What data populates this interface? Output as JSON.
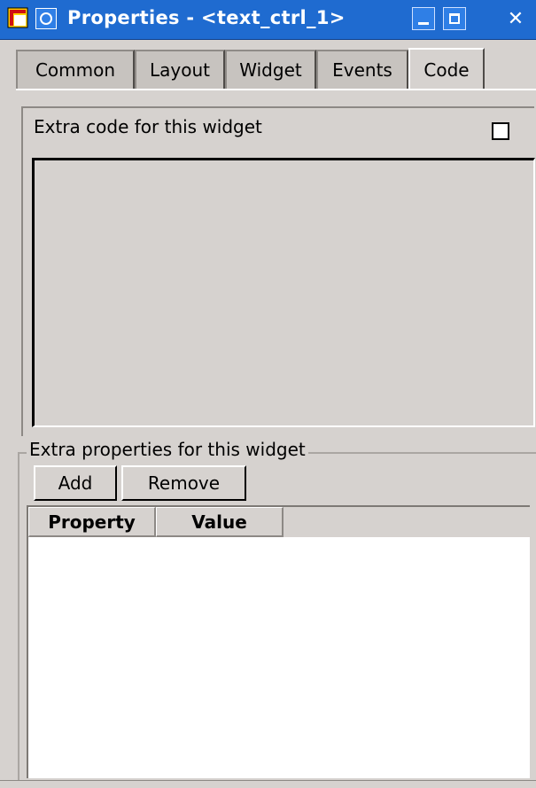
{
  "window": {
    "title": "Properties - <text_ctrl_1>",
    "close_glyph": "✕"
  },
  "tabs": [
    {
      "label": "Common"
    },
    {
      "label": "Layout"
    },
    {
      "label": "Widget"
    },
    {
      "label": "Events"
    },
    {
      "label": "Code",
      "active": true
    }
  ],
  "code_section": {
    "label": "Extra code for this widget",
    "checkbox_checked": false,
    "code_text": ""
  },
  "properties_section": {
    "group_label": "Extra properties for this widget",
    "add_label": "Add",
    "remove_label": "Remove",
    "columns": [
      "Property",
      "Value"
    ],
    "rows": []
  },
  "colors": {
    "titlebar": "#1f6bd0",
    "window_bg": "#d6d2cf",
    "table_bg": "#ffffff"
  },
  "icons": {
    "app": "properties-app-icon",
    "system_menu": "system-menu-icon",
    "minimize": "minimize-icon",
    "maximize": "maximize-icon",
    "close": "close-icon"
  }
}
